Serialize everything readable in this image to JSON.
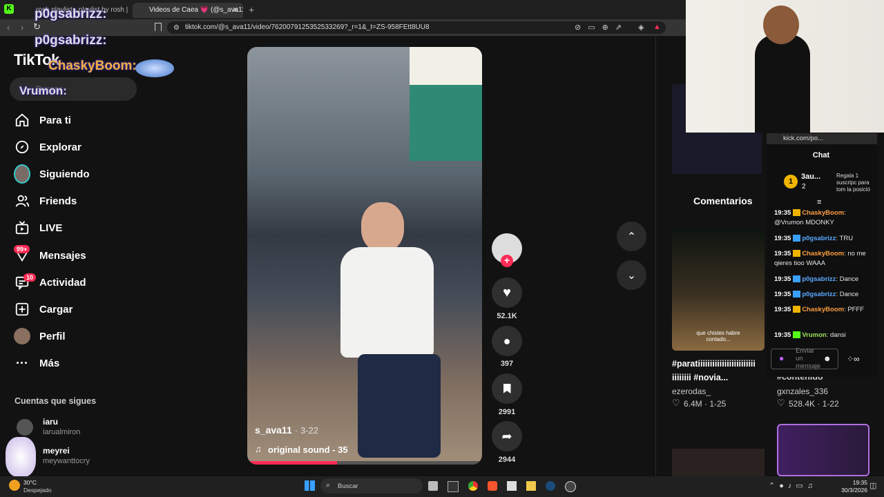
{
  "browser": {
    "tabs": [
      {
        "label": "rosh playlist - playlist by rosh | Sp..."
      },
      {
        "label": "Videos de Caea 💗 (@s_ava11..."
      }
    ],
    "url": "tiktok.com/@s_ava11/video/7620079125352533269?_r=1&_t=ZS-958FEtt8UU8"
  },
  "overlay_names": {
    "n1": "p0gsabrizz:",
    "n2": "p0gsabrizz:",
    "n3": "ChaskyBoom:",
    "n4": "Vrumon:"
  },
  "tiktok": {
    "logo": "TikTok",
    "search_placeholder": "Buscar",
    "nav": [
      {
        "label": "Para ti",
        "icon": "home-icon"
      },
      {
        "label": "Explorar",
        "icon": "compass-icon"
      },
      {
        "label": "Siguiendo",
        "icon": "avatar-icon"
      },
      {
        "label": "Friends",
        "icon": "friends-icon"
      },
      {
        "label": "LIVE",
        "icon": "live-tv-icon"
      },
      {
        "label": "Mensajes",
        "icon": "inbox-icon",
        "badge": "99+"
      },
      {
        "label": "Actividad",
        "icon": "activity-icon",
        "badge": "10"
      },
      {
        "label": "Cargar",
        "icon": "upload-icon"
      },
      {
        "label": "Perfil",
        "icon": "profile-icon"
      },
      {
        "label": "Más",
        "icon": "more-icon"
      }
    ],
    "following_title": "Cuentas que sigues",
    "following": [
      {
        "name": "iaru",
        "handle": "iarualmiron"
      },
      {
        "name": "meyrei",
        "handle": "meywanttocry"
      }
    ],
    "video": {
      "author": "s_ava11",
      "date": "· 3-22",
      "sound": "original sound - 35"
    },
    "actions": {
      "likes": "52.1K",
      "comments": "397",
      "saves": "2991",
      "shares": "2944"
    },
    "right_panel": {
      "comments_tab": "Comentarios",
      "cards": [
        {
          "caption": "#paratiiiiiiiiiiiiiiiiiiiiiiii iiiiiiii #novia...",
          "user": "ezerodas_",
          "stats": "6.4M · 1-25",
          "overlay": "que chistes habre contado..."
        },
        {
          "caption": "#contenido",
          "user": "gxnzales_336",
          "stats": "528.4K · 1-22"
        }
      ]
    }
  },
  "kick": {
    "url": "kick.com/po...",
    "chat_title": "Chat",
    "leader": {
      "rank": "1",
      "name": "3au...",
      "count": "2",
      "note": "Regala 1 suscripc para tom la posició"
    },
    "messages": [
      {
        "time": "19:35",
        "user": "ChaskyBoom",
        "text": "@Vrumon MDONKY",
        "color": "u1"
      },
      {
        "time": "19:35",
        "user": "p0gsabrizz",
        "text": "TRU",
        "color": "u2"
      },
      {
        "time": "19:35",
        "user": "ChaskyBoom",
        "text": "no me qieres tioo WAAA",
        "color": "u1"
      },
      {
        "time": "19:35",
        "user": "p0gsabrizz",
        "text": "Dance",
        "color": "u2"
      },
      {
        "time": "19:35",
        "user": "p0gsabrizz",
        "text": "Dance",
        "color": "u2"
      },
      {
        "time": "19:35",
        "user": "ChaskyBoom",
        "text": "PFFF",
        "color": "u1"
      },
      {
        "time": "19:35",
        "user": "Vrumon",
        "text": "dansi",
        "color": "u3"
      }
    ],
    "input_placeholder": "Enviar un mensaje"
  },
  "taskbar": {
    "weather_temp": "30°C",
    "weather_desc": "Despejado",
    "search": "Buscar",
    "time": "19:35",
    "date": "30/3/2026"
  },
  "colors": {
    "accent": "#fe2c55",
    "kick_green": "#53fc18"
  }
}
